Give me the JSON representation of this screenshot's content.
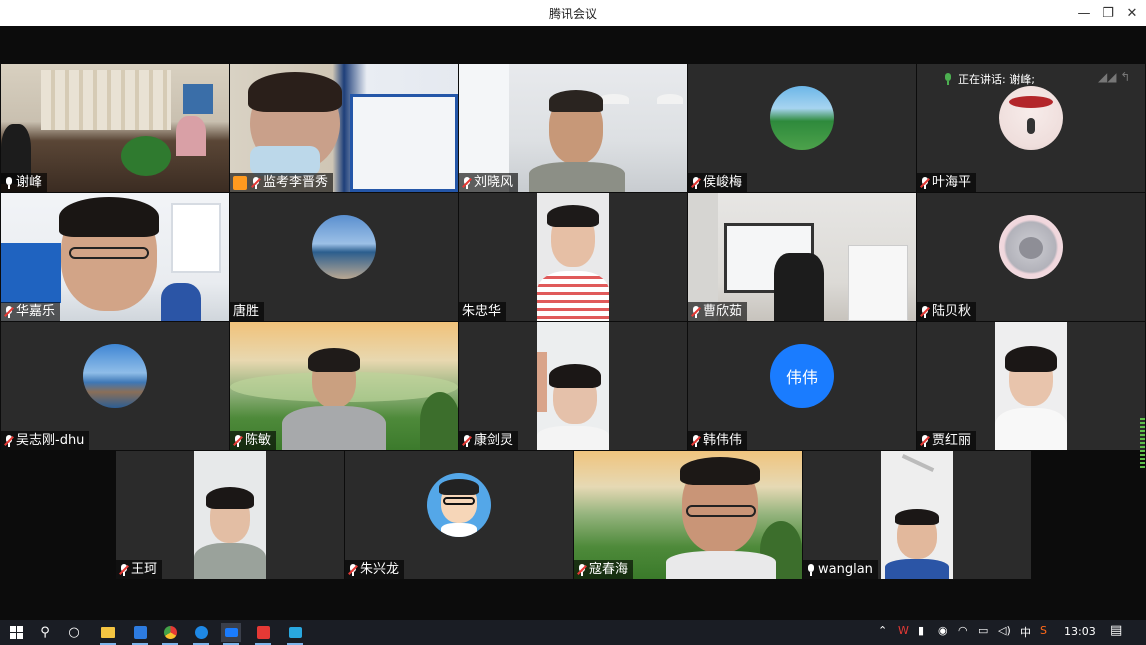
{
  "window": {
    "title": "腾讯会议",
    "minimize": "—",
    "maximize": "❐",
    "close": "✕"
  },
  "speaking": {
    "label": "正在讲话: 谢峰;"
  },
  "participants": [
    {
      "name": "谢峰"
    },
    {
      "name": "监考李晋秀"
    },
    {
      "name": "刘晓风"
    },
    {
      "name": "侯峻梅"
    },
    {
      "name": "叶海平"
    },
    {
      "name": "华嘉乐"
    },
    {
      "name": "唐胜"
    },
    {
      "name": "朱忠华"
    },
    {
      "name": "曹欣茹"
    },
    {
      "name": "陆贝秋"
    },
    {
      "name": "吴志刚-dhu"
    },
    {
      "name": "陈敏"
    },
    {
      "name": "康剑灵"
    },
    {
      "name": "韩伟伟",
      "avatar_text": "伟伟"
    },
    {
      "name": "贾红丽"
    },
    {
      "name": "王珂"
    },
    {
      "name": "朱兴龙"
    },
    {
      "name": "寇春海"
    },
    {
      "name": "wanglan"
    }
  ],
  "taskbar": {
    "search": "⚲",
    "taskview": "○",
    "ime": "中",
    "clock": "13:03",
    "notification": "▤"
  },
  "colors": {
    "accent_green": "#3bb54a",
    "avatar_blue": "#1a7cff",
    "tile_bg": "#2b2b2b"
  }
}
